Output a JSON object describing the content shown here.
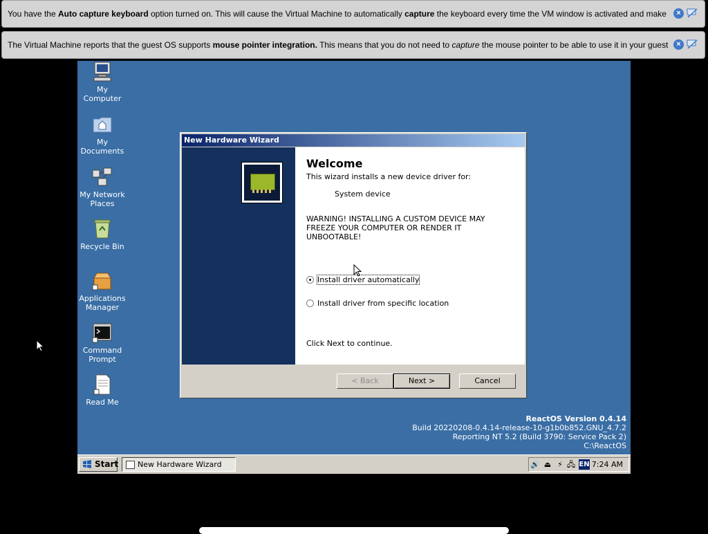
{
  "notifications": [
    {
      "parts": [
        "You have the ",
        "Auto capture keyboard",
        " option turned on. This will cause the Virtual Machine to automatically ",
        "capture",
        " the keyboard every time the VM window is activated and make it unavailable to"
      ]
    },
    {
      "parts": [
        "The Virtual Machine reports that the guest OS supports ",
        "mouse pointer integration.",
        " This means that you do not need to ",
        "capture",
        " the mouse pointer to be able to use it in your guest OS -- all mouse"
      ]
    }
  ],
  "desktop": {
    "icons": [
      {
        "label": "My\nComputer",
        "icon": "computer-icon"
      },
      {
        "label": "My\nDocuments",
        "icon": "documents-folder-icon"
      },
      {
        "label": "My Network\nPlaces",
        "icon": "network-icon"
      },
      {
        "label": "Recycle Bin",
        "icon": "recycle-bin-icon"
      },
      {
        "label": "Applications\nManager",
        "icon": "package-icon"
      },
      {
        "label": "Command\nPrompt",
        "icon": "terminal-icon"
      },
      {
        "label": "Read Me",
        "icon": "document-icon"
      }
    ]
  },
  "wizard": {
    "title": "New Hardware Wizard",
    "heading": "Welcome",
    "subtitle": "This wizard installs a new device driver for:",
    "device": "System device",
    "warning": "WARNING! INSTALLING A CUSTOM DEVICE MAY FREEZE YOUR COMPUTER OR RENDER IT UNBOOTABLE!",
    "option_auto": "Install driver automatically",
    "option_specific": "Install driver from specific location",
    "selected_option": "auto",
    "continue_text": "Click Next to continue.",
    "back_label": "< Back",
    "next_label": "Next >",
    "cancel_label": "Cancel"
  },
  "build_info": {
    "version": "ReactOS Version 0.4.14",
    "build": "Build 20220208-0.4.14-release-10-g1b0b852.GNU_4.7.2",
    "reporting": "Reporting NT 5.2 (Build 3790: Service Pack 2)",
    "path": "C:\\ReactOS"
  },
  "taskbar": {
    "start_label": "Start",
    "task_label": "New Hardware Wizard",
    "language": "EN",
    "clock": "7:24 AM"
  },
  "colors": {
    "desktop": "#3a6ea5",
    "titlebar_start": "#0a246a",
    "titlebar_end": "#a6caf0",
    "wizard_sidebar": "#14305c"
  }
}
